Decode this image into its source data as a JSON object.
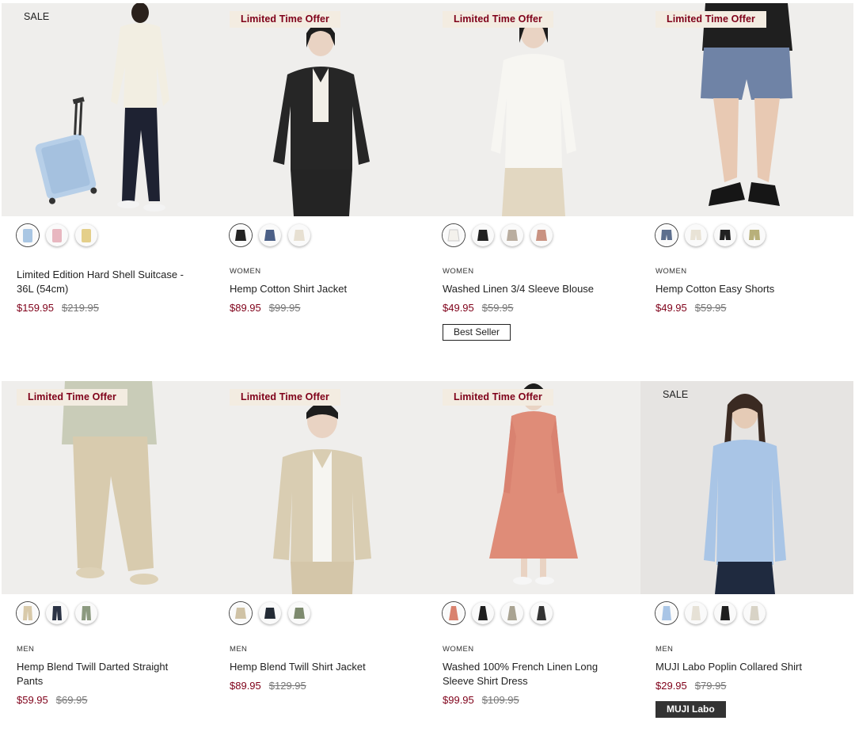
{
  "colors": {
    "accent": "#7f0019",
    "badge_bg": "#f3ece1",
    "dark_tag": "#333333"
  },
  "products": [
    {
      "badge": "SALE",
      "badge_type": "sale",
      "category": "",
      "name": "Limited Edition Hard Shell Suitcase - 36L (54cm)",
      "price": "$159.95",
      "orig_price": "$219.95",
      "tag": "",
      "swatch_colors": [
        "#a9c6e3",
        "#e8b7c0",
        "#e4cf8a"
      ],
      "swatch_icon": "suitcase"
    },
    {
      "badge": "Limited Time Offer",
      "badge_type": "offer",
      "category": "WOMEN",
      "name": "Hemp Cotton Shirt Jacket",
      "price": "$89.95",
      "orig_price": "$99.95",
      "tag": "",
      "swatch_colors": [
        "#222222",
        "#4b5f86",
        "#e7e0d2"
      ],
      "swatch_icon": "jacket"
    },
    {
      "badge": "Limited Time Offer",
      "badge_type": "offer",
      "category": "WOMEN",
      "name": "Washed Linen 3/4 Sleeve Blouse",
      "price": "$49.95",
      "orig_price": "$59.95",
      "tag": "Best Seller",
      "swatch_colors": [
        "#f3f1ec",
        "#222222",
        "#b9ad9f",
        "#c99281"
      ],
      "swatch_icon": "blouse"
    },
    {
      "badge": "Limited Time Offer",
      "badge_type": "offer",
      "category": "WOMEN",
      "name": "Hemp Cotton Easy Shorts",
      "price": "$49.95",
      "orig_price": "$59.95",
      "tag": "",
      "swatch_colors": [
        "#5d6f8e",
        "#e9e3d6",
        "#222222",
        "#b8b07a"
      ],
      "swatch_icon": "shorts"
    },
    {
      "badge": "Limited Time Offer",
      "badge_type": "offer",
      "category": "MEN",
      "name": "Hemp Blend Twill Darted Straight Pants",
      "price": "$59.95",
      "orig_price": "$69.95",
      "tag": "",
      "swatch_colors": [
        "#d8c9a9",
        "#2b3345",
        "#8c9a80"
      ],
      "swatch_icon": "pants"
    },
    {
      "badge": "Limited Time Offer",
      "badge_type": "offer",
      "category": "MEN",
      "name": "Hemp Blend Twill Shirt Jacket",
      "price": "$89.95",
      "orig_price": "$129.95",
      "tag": "",
      "swatch_colors": [
        "#cfc2a5",
        "#232b35",
        "#7d8a6e"
      ],
      "swatch_icon": "jacket"
    },
    {
      "badge": "Limited Time Offer",
      "badge_type": "offer",
      "category": "WOMEN",
      "name": "Washed 100% French Linen Long Sleeve Shirt Dress",
      "price": "$99.95",
      "orig_price": "$109.95",
      "tag": "",
      "swatch_colors": [
        "#d9826e",
        "#1f1f1f",
        "#a9a392",
        "#333333"
      ],
      "swatch_icon": "dress"
    },
    {
      "badge": "SALE",
      "badge_type": "sale",
      "category": "MEN",
      "name": "MUJI Labo Poplin Collared Shirt",
      "price": "$29.95",
      "orig_price": "$79.95",
      "tag": "MUJI Labo",
      "tag_type": "dark",
      "swatch_colors": [
        "#a9c5e6",
        "#e6e1d6",
        "#1f1f1f",
        "#d8d3c6"
      ],
      "swatch_icon": "shirt"
    }
  ]
}
